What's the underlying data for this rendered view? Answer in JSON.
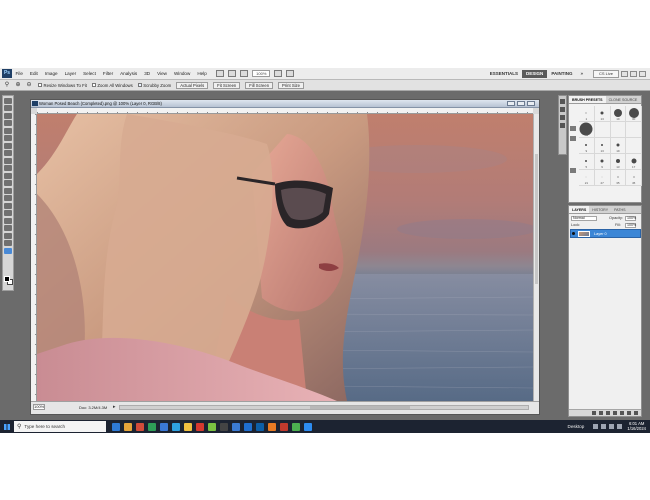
{
  "menubar": {
    "logo": "Ps",
    "items": [
      "File",
      "Edit",
      "Image",
      "Layer",
      "Select",
      "Filter",
      "Analysis",
      "3D",
      "View",
      "Window",
      "Help"
    ],
    "zoom": "100%",
    "workspaces": [
      "ESSENTIALS",
      "DESIGN",
      "PAINTING"
    ],
    "active_workspace": "DESIGN",
    "overflow": "»",
    "cs_live": "CS Live"
  },
  "options": {
    "checkboxes": [
      "Resize Windows To Fit",
      "Zoom All Windows",
      "Scrubby Zoom"
    ],
    "buttons": [
      "Actual Pixels",
      "Fit Screen",
      "Fill Screen",
      "Print Size"
    ]
  },
  "document": {
    "title": "Woman Posed Beach (Completed).png @ 100% (Layer 0, RGB/8)",
    "zoom": "100%",
    "info": "Doc: 3.2M/4.3M"
  },
  "brush_panel": {
    "tabs": [
      "BRUSH PRESETS",
      "CLONE SOURCE"
    ],
    "brushes": [
      {
        "size": 1,
        "label": "1"
      },
      {
        "size": 3,
        "label": "13"
      },
      {
        "size": 8,
        "label": "19"
      },
      {
        "size": 10,
        "label": "30"
      },
      {
        "size": 13,
        "label": "45"
      },
      {
        "size": 0,
        "label": ""
      },
      {
        "size": 0,
        "label": ""
      },
      {
        "size": 0,
        "label": ""
      },
      {
        "size": 2,
        "label": "9"
      },
      {
        "size": 2,
        "label": "13"
      },
      {
        "size": 3,
        "label": "19"
      },
      {
        "size": 0,
        "label": ""
      },
      {
        "size": 2,
        "label": "5"
      },
      {
        "size": 3,
        "label": "9"
      },
      {
        "size": 4,
        "label": "13"
      },
      {
        "size": 5,
        "label": "17"
      },
      {
        "size": 1,
        "label": "21"
      },
      {
        "size": 1,
        "label": "27"
      },
      {
        "size": 2,
        "label": "35"
      },
      {
        "size": 2,
        "label": "45"
      }
    ]
  },
  "layers_panel": {
    "tabs": [
      "LAYERS",
      "HISTORY",
      "PATHS"
    ],
    "blend_mode": "Normal",
    "opacity_label": "Opacity:",
    "opacity_value": "100%",
    "lock_label": "Lock:",
    "fill_label": "Fill:",
    "fill_value": "100%",
    "layer_name": "Layer 0"
  },
  "taskbar": {
    "search_placeholder": "Type here to search",
    "desktop_label": "Desktop",
    "time": "6:01 AM",
    "date": "1/16/2024",
    "app_colors": [
      "#2f7bd6",
      "#e5a53a",
      "#d24c3a",
      "#2e9e57",
      "#3a78d6",
      "#2fa2e0",
      "#f0c040",
      "#d6392f",
      "#7ac142",
      "#444444",
      "#3b7bd4",
      "#1f6fd1",
      "#0d5fa8",
      "#e87b24",
      "#c23a2d",
      "#4caf50",
      "#2d8cf0"
    ]
  }
}
